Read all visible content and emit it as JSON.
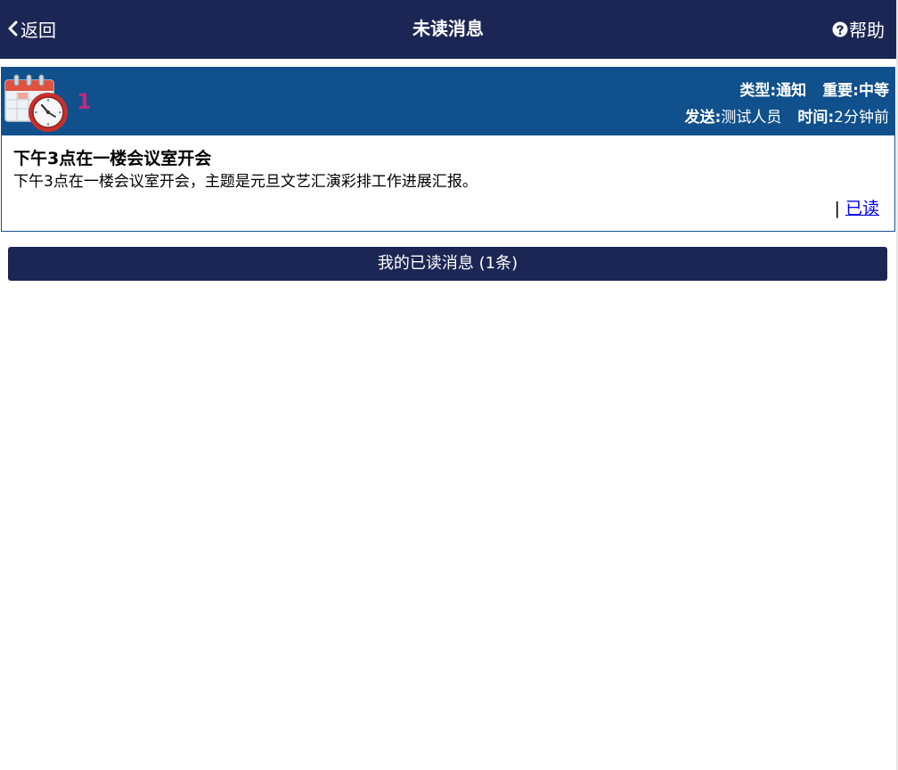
{
  "nav": {
    "back_label": "返回",
    "title": "未读消息",
    "help_label": "帮助"
  },
  "message": {
    "index": "1",
    "type_label": "类型:",
    "type_value": "通知",
    "importance_label": "重要:",
    "importance_value": "中等",
    "sender_label": "发送:",
    "sender_value": "测试人员",
    "time_label": "时间:",
    "time_value": "2分钟前",
    "title": "下午3点在一楼会议室开会",
    "body": "下午3点在一楼会议室开会，主题是元旦文艺汇演彩排工作进展汇报。",
    "separator": "|",
    "mark_read_label": "已读"
  },
  "read_section": {
    "label": "我的已读消息 (1条)"
  },
  "colors": {
    "nav_bg": "#1c2654",
    "card_header_bg": "#10508c",
    "index_color": "#c4267e",
    "link_color": "#0000ee"
  },
  "icons": {
    "back": "chevron-left-icon",
    "help": "question-circle-icon",
    "message": "calendar-clock-icon"
  }
}
